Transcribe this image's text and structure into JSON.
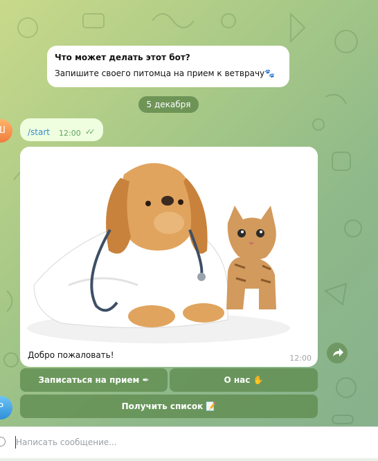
{
  "bot_info": {
    "title": "Что может делать этот бот?",
    "description": "Запишите своего питомца на прием к ветврачу🐾"
  },
  "date_separator": "5 декабря",
  "avatars": {
    "user_initial": "Ш",
    "second_initial": "Р"
  },
  "outgoing_message": {
    "text": "/start",
    "time": "12:00",
    "status_ticks": "✓✓"
  },
  "photo_message": {
    "caption": "Добро пожаловать!",
    "time": "12:00",
    "image_description": "dog-in-vet-coat-with-kitten"
  },
  "keyboard": {
    "appoint_label": "Записаться на прием ✒",
    "about_label": "О нас ✋",
    "list_label": "Получить список 📝"
  },
  "composer": {
    "placeholder": "Написать сообщение..."
  },
  "colors": {
    "accent": "#3a8ad0",
    "bubble_out": "#eefedf",
    "button_bg": "#5f8c50"
  }
}
